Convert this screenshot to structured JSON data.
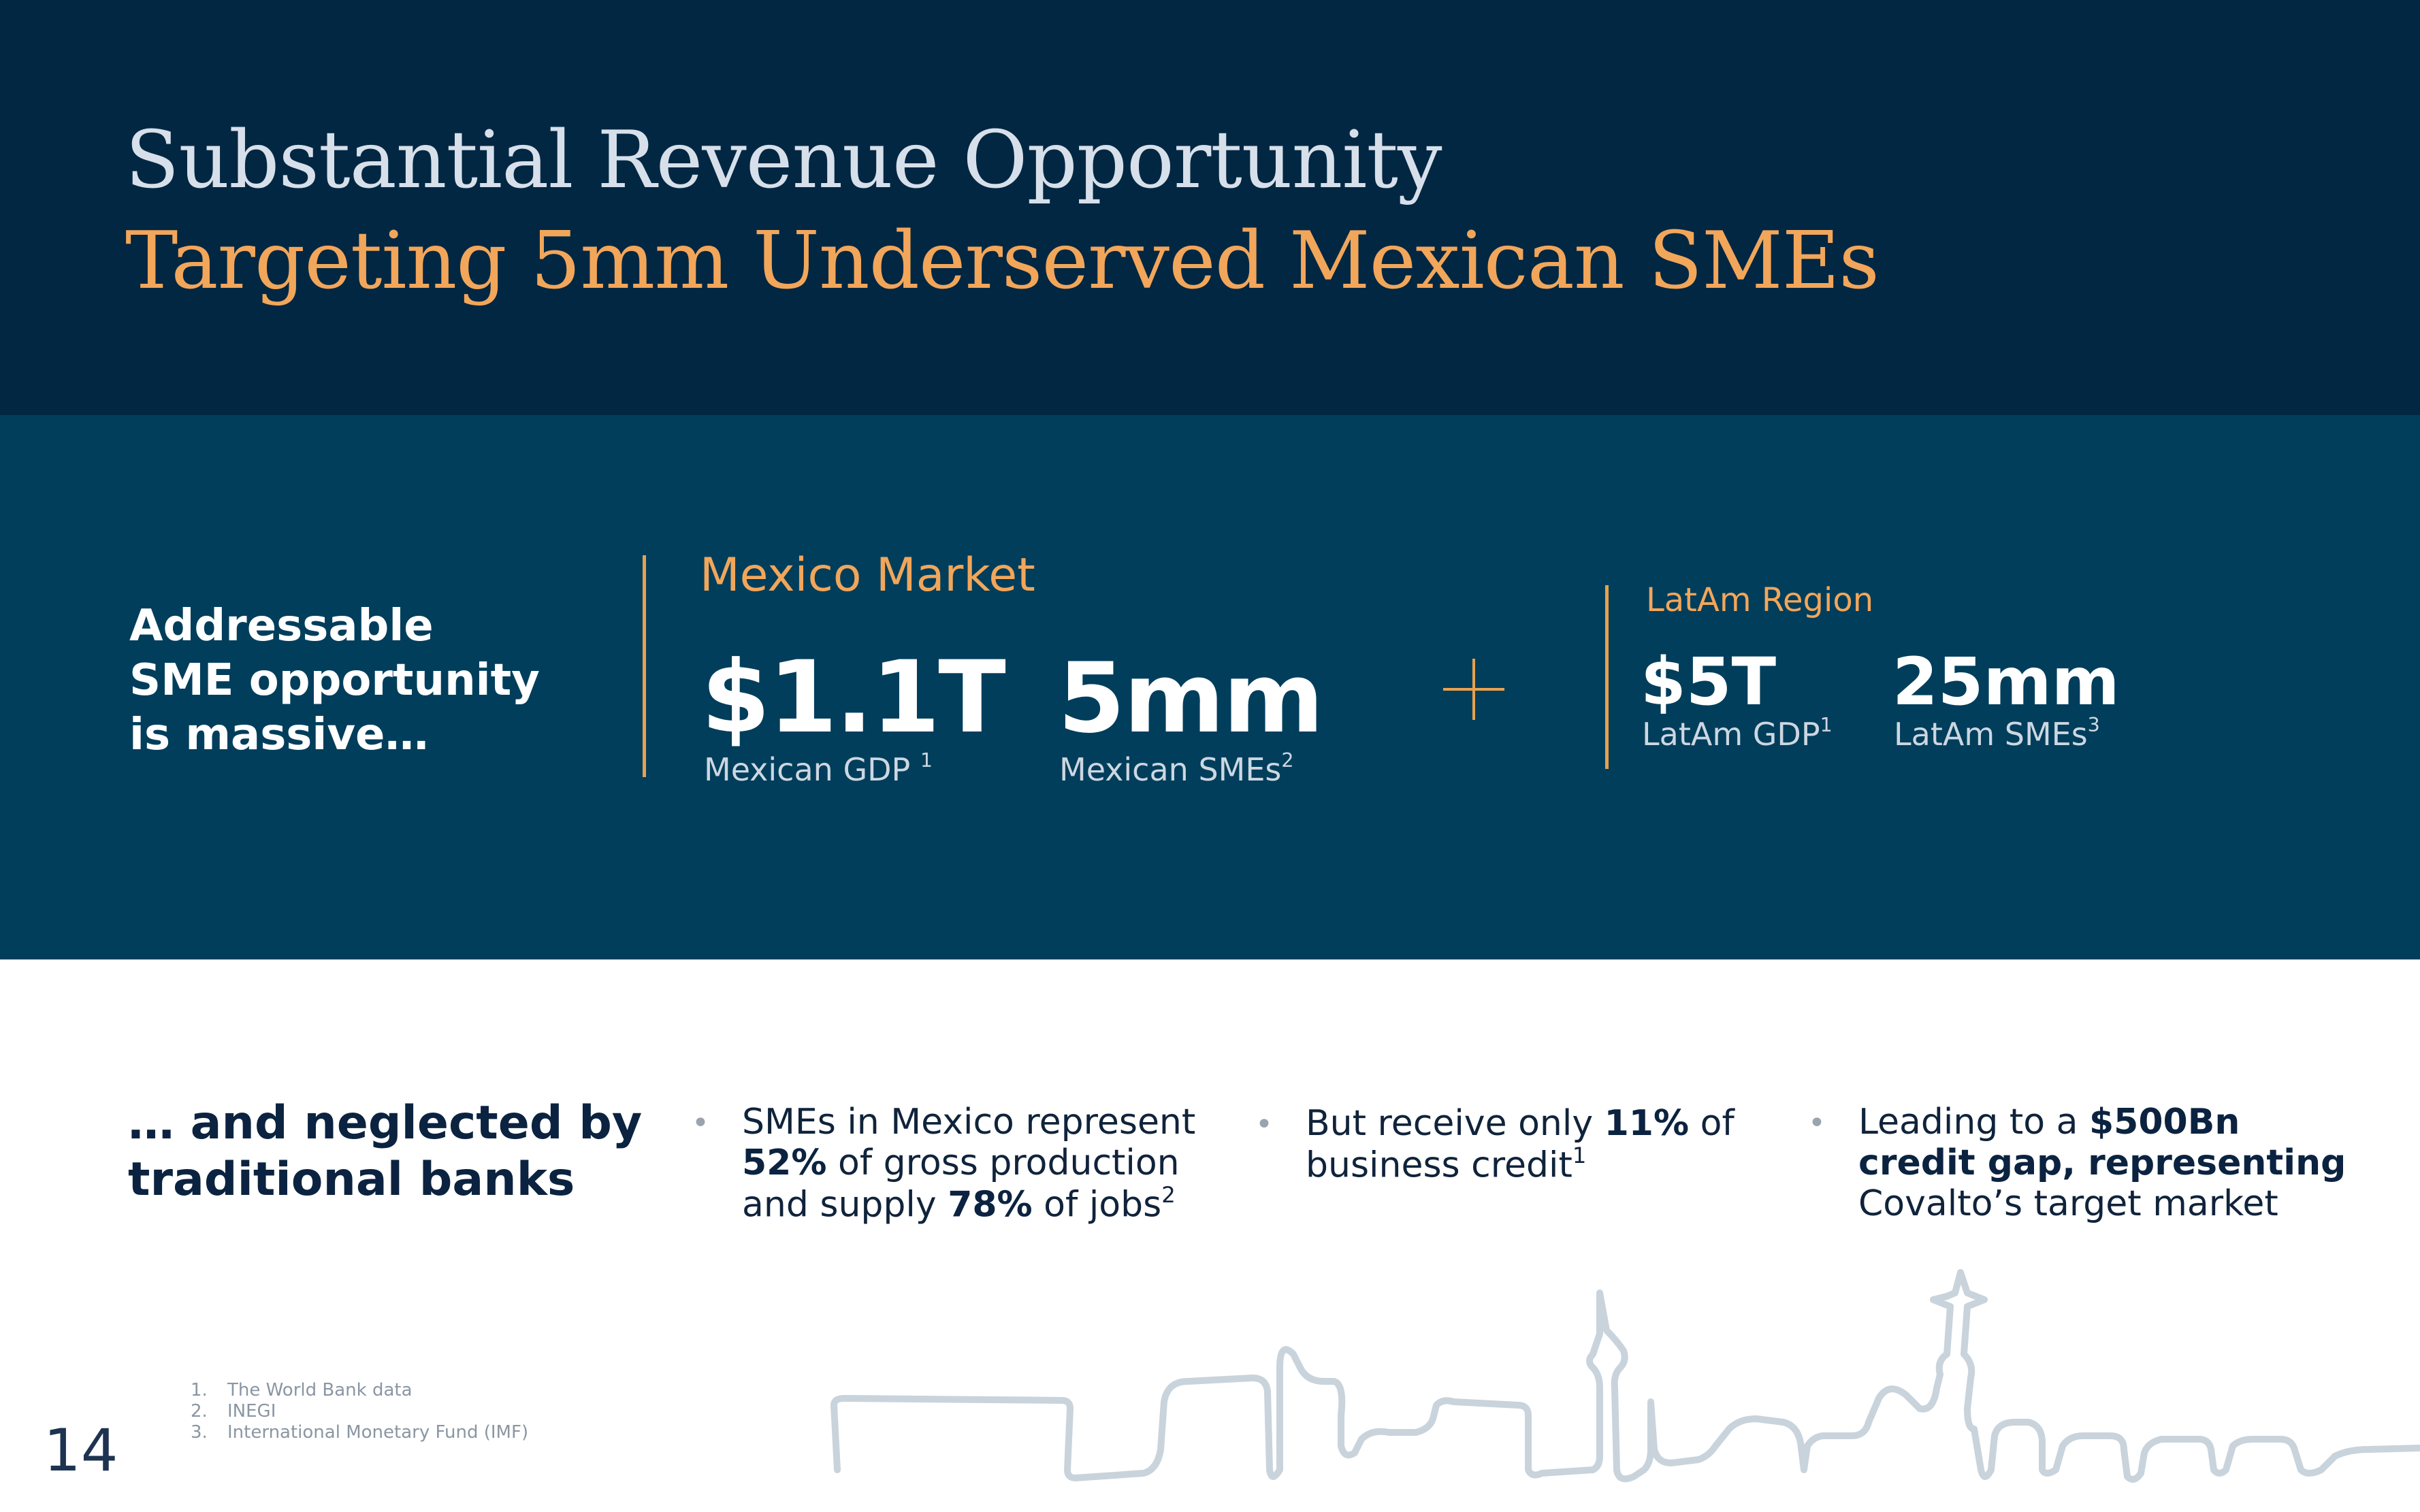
{
  "header": {
    "title": "Substantial Revenue Opportunity",
    "subtitle": "Targeting 5mm Underserved Mexican SMEs"
  },
  "opportunity": {
    "heading_lines": [
      "Addressable",
      "SME opportunity",
      "is massive…"
    ],
    "mexico": {
      "label": "Mexico Market",
      "gdp_value": "$1.1T",
      "gdp_caption": "Mexican GDP",
      "gdp_ref": "1",
      "smes_value": "5mm",
      "smes_caption": "Mexican SMEs",
      "smes_ref": "2"
    },
    "latam": {
      "label": "LatAm Region",
      "gdp_value": "$5T",
      "gdp_caption": "LatAm GDP",
      "gdp_ref": "1",
      "smes_value": "25mm",
      "smes_caption": "LatAm SMEs",
      "smes_ref": "3"
    }
  },
  "neglected": {
    "heading_lines": [
      "… and neglected by",
      "traditional banks"
    ],
    "bullets": [
      {
        "line1": "SMEs in Mexico represent",
        "pct1": "52%",
        "line2_rest": " of gross production",
        "line3_pre": "and supply ",
        "pct2": "78%",
        "line3_post": " of jobs",
        "ref": "2"
      },
      {
        "line1_pre": "But receive only ",
        "pct": "11%",
        "line1_post": " of",
        "line2": "business credit",
        "ref": "1"
      },
      {
        "line1_pre": "Leading to a ",
        "bold1": "$500Bn",
        "bold2": "credit gap, representing",
        "line3": "Covalto’s target market"
      }
    ]
  },
  "footnotes": [
    {
      "num": "1.",
      "text": "The World Bank data"
    },
    {
      "num": "2.",
      "text": "INEGI"
    },
    {
      "num": "3.",
      "text": "International Monetary Fund (IMF)"
    }
  ],
  "page_number": "14",
  "colors": {
    "header_bg": "#022743",
    "band_bg": "#013e5c",
    "accent": "#f2a65a",
    "title": "#d7e0ea",
    "skyline": "#c9d3dc"
  }
}
